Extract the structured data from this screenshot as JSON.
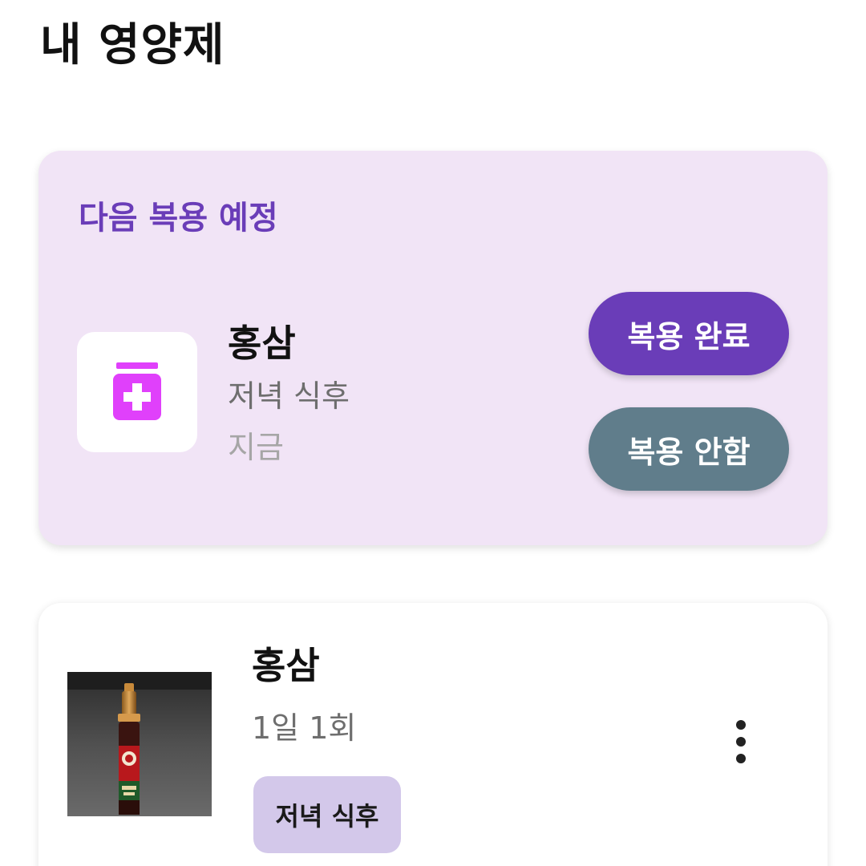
{
  "header": {
    "title": "내 영양제"
  },
  "next_dose": {
    "heading": "다음 복용 예정",
    "icon": "medicine-bottle-icon",
    "name": "홍삼",
    "timing": "저녁 식후",
    "when": "지금",
    "done_label": "복용 완료",
    "skip_label": "복용 안함"
  },
  "supplements": [
    {
      "name": "홍삼",
      "frequency": "1일 1회",
      "tag": "저녁 식후",
      "more_icon": "more-vertical-icon"
    }
  ],
  "colors": {
    "accent": "#6a3db8",
    "card_bg": "#f1e4f6",
    "skip_button": "#607d8b",
    "icon_magenta": "#e040fb",
    "tag_bg": "#d3c8ea"
  }
}
